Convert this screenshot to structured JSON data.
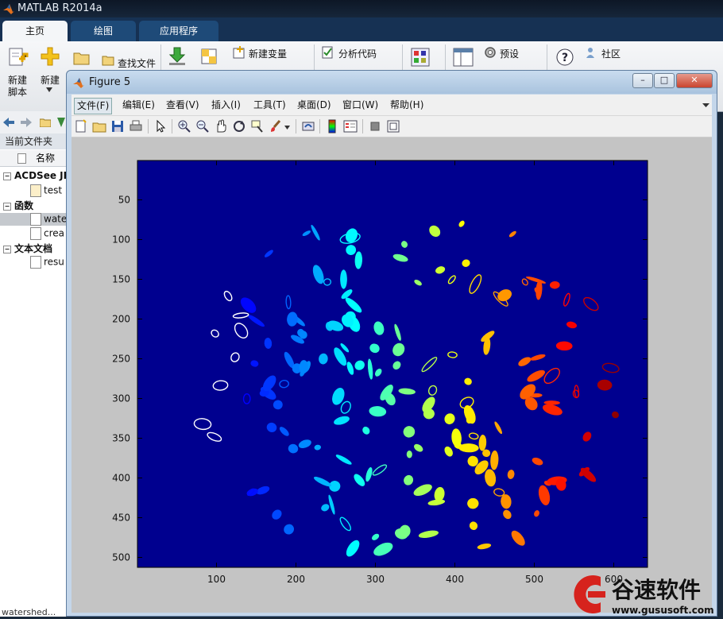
{
  "app": {
    "title": "MATLAB R2014a"
  },
  "main_tabs": [
    {
      "label": "主页",
      "active": true
    },
    {
      "label": "绘图",
      "active": false
    },
    {
      "label": "应用程序",
      "active": false
    }
  ],
  "ribbon": {
    "new_script": "新建\n脚本",
    "new_script_line1": "新建",
    "new_script_line2": "脚本",
    "new_label": "新建",
    "find_files": "查找文件",
    "new_variable": "新建变量",
    "analyze_code": "分析代码",
    "preferences": "预设",
    "community": "社区"
  },
  "left_panel": {
    "current_folder": "当前文件夹",
    "name_header": "名称",
    "items": [
      {
        "label": "ACDSee JP",
        "type": "group"
      },
      {
        "label": "test",
        "type": "file"
      },
      {
        "label": "函数",
        "type": "group"
      },
      {
        "label": "wate",
        "type": "file",
        "selected": true
      },
      {
        "label": "crea",
        "type": "file"
      },
      {
        "label": "文本文档",
        "type": "group"
      },
      {
        "label": "resu",
        "type": "file"
      }
    ],
    "status": "watershed..."
  },
  "figure": {
    "title": "Figure 5",
    "menus": [
      "文件(F)",
      "编辑(E)",
      "查看(V)",
      "插入(I)",
      "工具(T)",
      "桌面(D)",
      "窗口(W)",
      "帮助(H)"
    ],
    "toolbar_icons": [
      "new-figure-icon",
      "open-icon",
      "save-icon",
      "print-icon",
      "pointer-icon",
      "zoom-in-icon",
      "zoom-out-icon",
      "pan-icon",
      "rotate-icon",
      "data-cursor-icon",
      "brush-icon",
      "link-icon",
      "colorbar-icon",
      "legend-icon",
      "hide-plot-tools-icon",
      "show-plot-tools-icon"
    ]
  },
  "chart_data": {
    "type": "heatmap",
    "title": "",
    "xlabel": "",
    "ylabel": "",
    "xlim": [
      0.5,
      642.5
    ],
    "ylim": [
      512.5,
      0.5
    ],
    "xticks": [
      100,
      200,
      300,
      400,
      500,
      600
    ],
    "yticks": [
      50,
      100,
      150,
      200,
      250,
      300,
      350,
      400,
      450,
      500
    ],
    "colormap": "jet",
    "background_color": "#00008F"
  },
  "watermark": {
    "brand": "谷速软件",
    "url": "www.gususoft.com"
  }
}
